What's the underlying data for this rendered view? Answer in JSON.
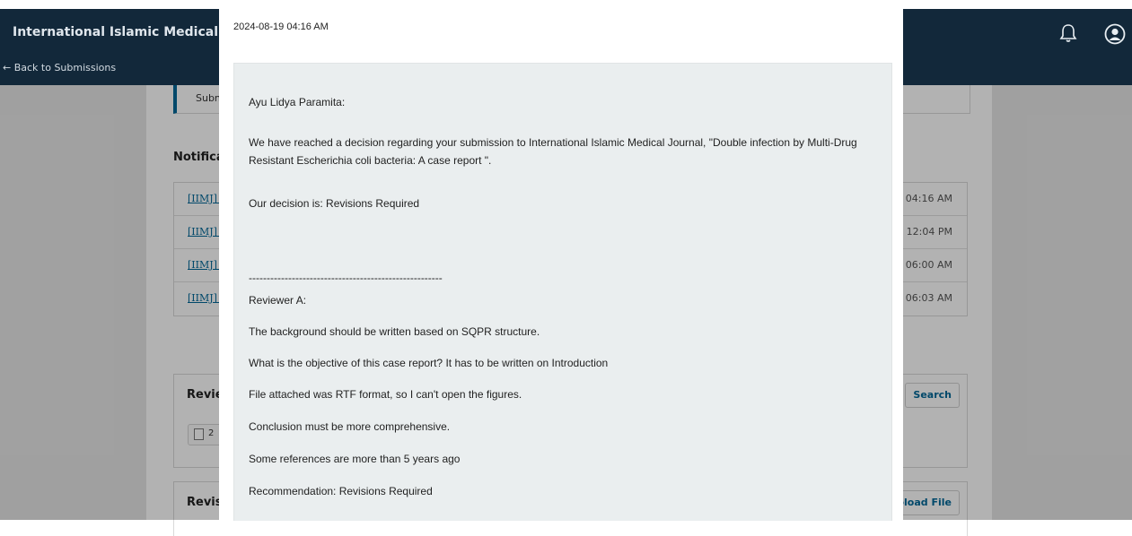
{
  "app": {
    "title": "International Islamic Medical Journal",
    "back_link": "← Back to Submissions"
  },
  "submission_box": {
    "label": "Subn"
  },
  "notifications": {
    "heading": "Notifications",
    "rows": [
      {
        "link": "[IIMJ] Editor Decision",
        "time": "04:16 AM"
      },
      {
        "link": "[IIMJ] Editor Decision",
        "time": "12:04 PM"
      },
      {
        "link": "[IIMJ] Editor Decision",
        "time": "06:00 AM"
      },
      {
        "link": "[IIMJ] Editor Decision",
        "time": "06:03 AM"
      }
    ]
  },
  "reviewer_files": {
    "title": "Reviewer Files",
    "button": "Search",
    "file_number": "2"
  },
  "revisions": {
    "title": "Revisions",
    "button": "Upload File"
  },
  "modal": {
    "date": "2024-08-19 04:16 AM",
    "greeting": "Ayu Lidya Paramita:",
    "intro": "We have reached a decision regarding your submission to International Islamic Medical Journal, \"Double infection by Multi-Drug Resistant Escherichia coli bacteria: A case report \".",
    "decision": "Our decision is: Revisions Required",
    "separator": "------------------------------------------------------",
    "reviewer": "Reviewer A:",
    "comments": [
      "The background should be written based on SQPR structure.",
      "What is the objective of this case report? It has to be written on Introduction",
      "File attached was RTF format, so I can't open the figures.",
      "Conclusion must be more comprehensive.",
      "Some references are more than 5 years ago"
    ],
    "recommendation": "Recommendation: Revisions Required"
  },
  "icons": {
    "bell": "bell-icon",
    "user": "user-icon",
    "file": "file-icon"
  },
  "colors": {
    "header": "#12283a",
    "link": "#006798",
    "message_bg": "#eaeeef"
  }
}
